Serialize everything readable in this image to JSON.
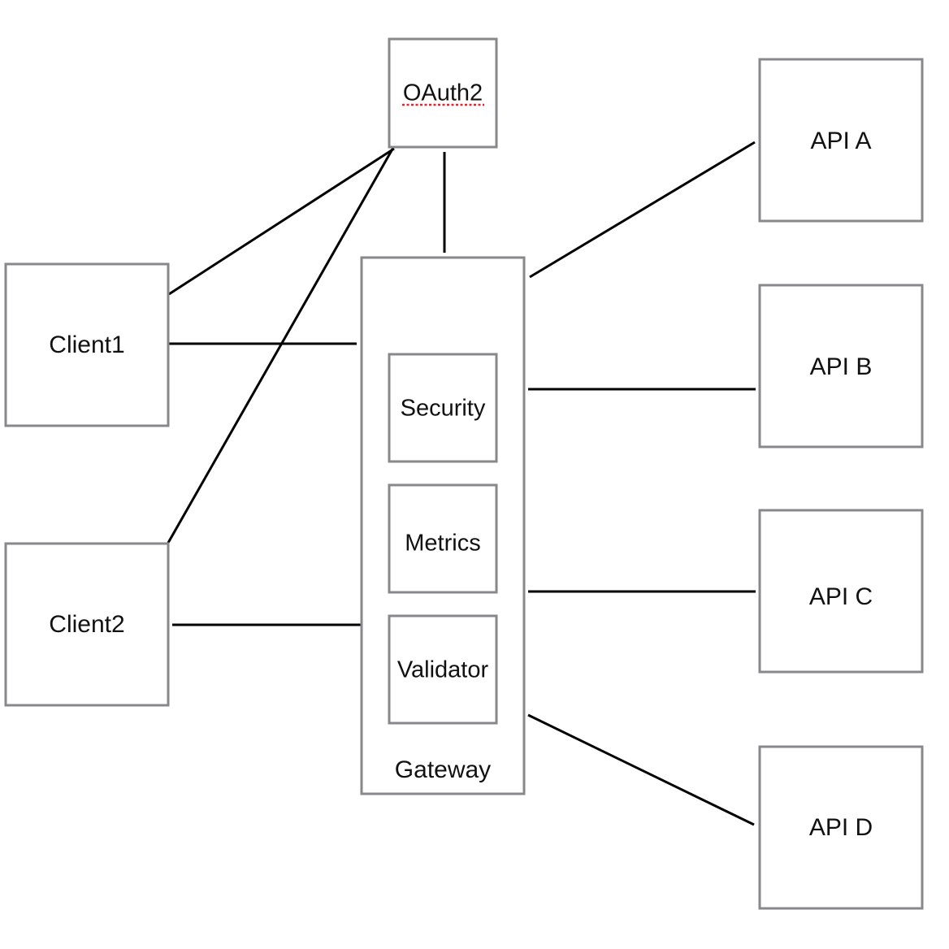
{
  "nodes": {
    "oauth2": "OAuth2",
    "client1": "Client1",
    "client2": "Client2",
    "gateway": "Gateway",
    "security": "Security",
    "metrics": "Metrics",
    "validator": "Validator",
    "api_a": "API A",
    "api_b": "API B",
    "api_c": "API C",
    "api_d": "API D"
  },
  "connections": [
    [
      "Client1",
      "OAuth2"
    ],
    [
      "Client2",
      "OAuth2"
    ],
    [
      "OAuth2",
      "Gateway"
    ],
    [
      "Client1",
      "Gateway"
    ],
    [
      "Client2",
      "Gateway"
    ],
    [
      "Gateway",
      "API A"
    ],
    [
      "Gateway",
      "API B"
    ],
    [
      "Gateway",
      "API C"
    ],
    [
      "Gateway",
      "API D"
    ]
  ],
  "colors": {
    "box_border": "#88888c",
    "line": "#000000",
    "spellcheck_underline": "#e8222c"
  }
}
